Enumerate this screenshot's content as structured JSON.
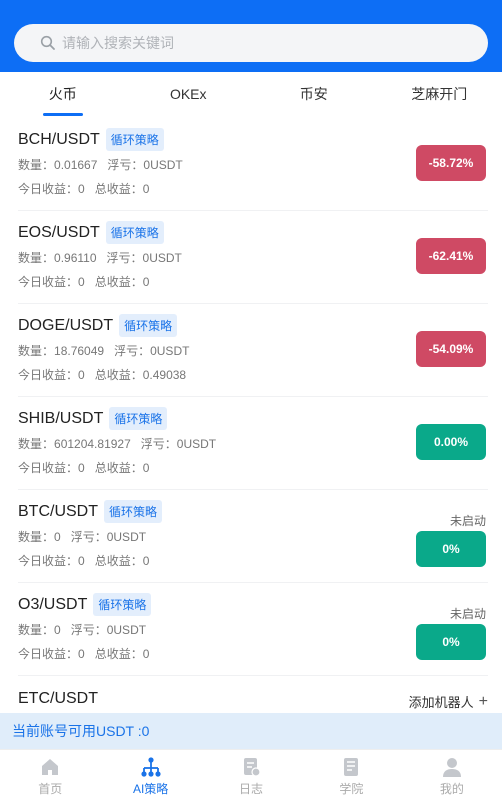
{
  "search": {
    "placeholder": "请输入搜索关键词"
  },
  "tabs": [
    {
      "label": "火币"
    },
    {
      "label": "OKEx"
    },
    {
      "label": "币安"
    },
    {
      "label": "芝麻开门"
    }
  ],
  "labels": {
    "qty": "数量：",
    "float": "浮亏：",
    "today": "今日收益：",
    "total": "总收益："
  },
  "bots": [
    {
      "pair": "BCH/USDT",
      "tag": "循环策略",
      "qty": "0.01667",
      "float": "0USDT",
      "today": "0",
      "total": "0",
      "status": "",
      "pct": "-58.72%"
    },
    {
      "pair": "EOS/USDT",
      "tag": "循环策略",
      "qty": "0.96110",
      "float": "0USDT",
      "today": "0",
      "total": "0",
      "status": "",
      "pct": "-62.41%"
    },
    {
      "pair": "DOGE/USDT",
      "tag": "循环策略",
      "qty": "18.76049",
      "float": "0USDT",
      "today": "0",
      "total": "0.49038",
      "status": "",
      "pct": "-54.09%"
    },
    {
      "pair": "SHIB/USDT",
      "tag": "循环策略",
      "qty": "601204.81927",
      "float": "0USDT",
      "today": "0",
      "total": "0",
      "status": "",
      "pct": "0.00%"
    },
    {
      "pair": "BTC/USDT",
      "tag": "循环策略",
      "qty": "0",
      "float": "0USDT",
      "today": "0",
      "total": "0",
      "status": "未启动",
      "pct": "0%"
    },
    {
      "pair": "O3/USDT",
      "tag": "循环策略",
      "qty": "0",
      "float": "0USDT",
      "today": "0",
      "total": "0",
      "status": "未启动",
      "pct": "0%"
    }
  ],
  "partial_bot": {
    "pair": "ETC/USDT",
    "add_label": "添加机器人",
    "add_icon": "plus-icon"
  },
  "balance_text": "当前账号可用USDT :0",
  "bottom_nav": [
    {
      "label": "首页",
      "icon": "home-icon"
    },
    {
      "label": "AI策略",
      "icon": "strategy-icon"
    },
    {
      "label": "日志",
      "icon": "log-icon"
    },
    {
      "label": "学院",
      "icon": "book-icon"
    },
    {
      "label": "我的",
      "icon": "user-icon"
    }
  ],
  "colors": {
    "primary": "#0d6ef5",
    "loss": "#cf4a64",
    "gain": "#0aa98a",
    "balance_bg": "#e0edfa"
  }
}
